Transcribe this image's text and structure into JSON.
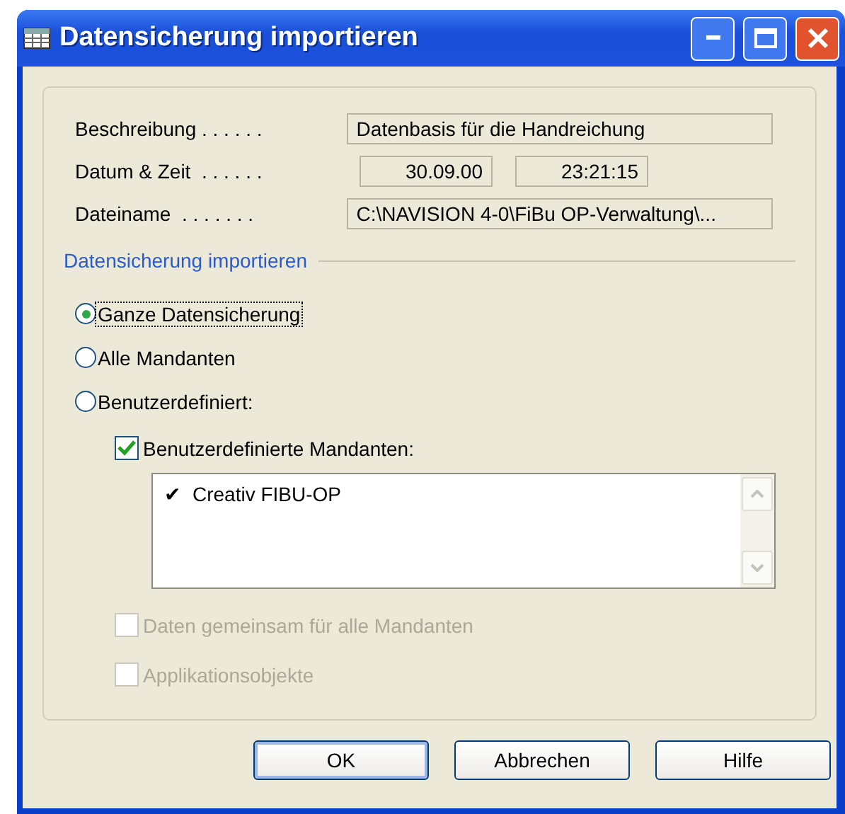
{
  "window": {
    "title": "Datensicherung importieren"
  },
  "fields": [
    {
      "label": "Beschreibung . . . . . .",
      "values": [
        "Datenbasis für die Handreichung"
      ]
    },
    {
      "label": "Datum & Zeit  . . . . . .",
      "values": [
        "30.09.00",
        "23:21:15"
      ]
    },
    {
      "label": "Dateiname  . . . . . . .",
      "values": [
        "C:\\NAVISION 4-0\\FiBu OP-Verwaltung\\..."
      ]
    }
  ],
  "section": {
    "title": "Datensicherung importieren"
  },
  "options": [
    {
      "label": "Ganze Datensicherung",
      "selected": true,
      "focused": true
    },
    {
      "label": "Alle Mandanten",
      "selected": false,
      "focused": false
    },
    {
      "label": "Benutzerdefiniert:",
      "selected": false,
      "focused": false
    }
  ],
  "custom_companies": {
    "label": "Benutzerdefinierte Mandanten:",
    "checked": true,
    "disabled": false,
    "items": [
      {
        "mark": "✔",
        "label": "Creativ FIBU-OP"
      }
    ]
  },
  "extra_options": [
    {
      "label": "Daten gemeinsam für alle Mandanten",
      "checked": false,
      "disabled": true
    },
    {
      "label": "Applikationsobjekte",
      "checked": false,
      "disabled": true
    }
  ],
  "buttons": [
    {
      "label": "OK",
      "default": true
    },
    {
      "label": "Abbrechen",
      "default": false
    },
    {
      "label": "Hilfe",
      "default": false
    }
  ]
}
